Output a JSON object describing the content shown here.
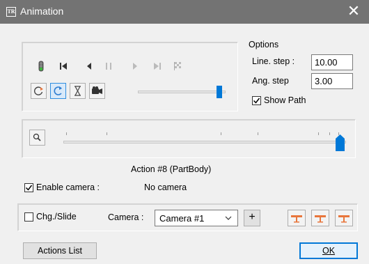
{
  "window": {
    "title": "Animation",
    "app_icon_text": "TR"
  },
  "options": {
    "group_label": "Options",
    "line_step_label": "Line. step :",
    "line_step_value": "10.00",
    "ang_step_label": "Ang. step",
    "ang_step_value": "3.00",
    "show_path_label": "Show Path",
    "show_path_checked": true
  },
  "playback": {
    "speed_slider_level": 0.93
  },
  "timeline": {
    "position": 0.98
  },
  "action_label": "Action #8 (PartBody)",
  "camera_section": {
    "enable_camera_label": "Enable camera :",
    "enable_camera_checked": true,
    "camera_status": "No camera",
    "chg_slide_label": "Chg./Slide",
    "chg_slide_checked": false,
    "camera_label": "Camera :",
    "camera_selected": "Camera #1",
    "add_label": "+"
  },
  "footer": {
    "actions_list_label": "Actions List",
    "ok_label": "OK"
  },
  "colors": {
    "titlebar": "#737373",
    "accent": "#0078d7",
    "traffic_green": "#3dbb3d",
    "camera_icon_orange": "#e8763c"
  }
}
